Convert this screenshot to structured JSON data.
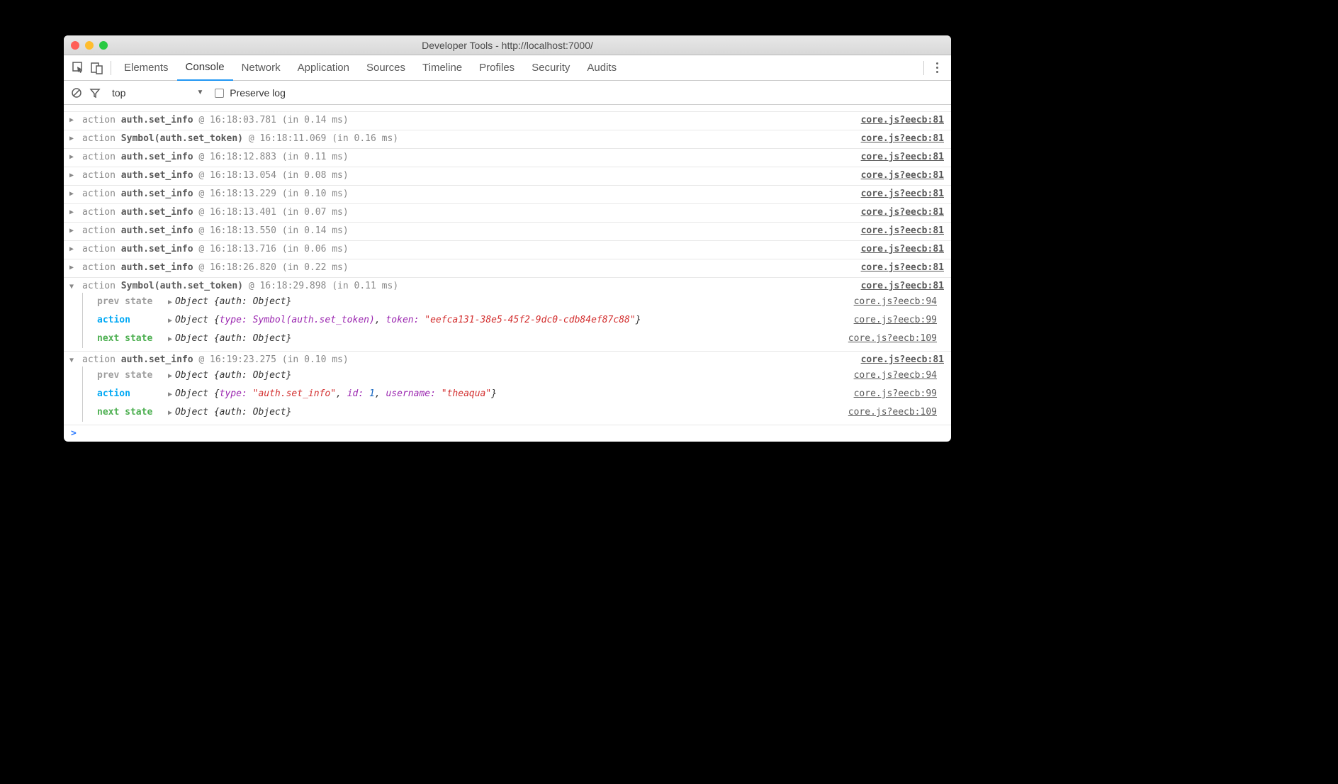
{
  "window": {
    "title": "Developer Tools - http://localhost:7000/"
  },
  "tabs": {
    "elements": "Elements",
    "console": "Console",
    "network": "Network",
    "application": "Application",
    "sources": "Sources",
    "timeline": "Timeline",
    "profiles": "Profiles",
    "security": "Security",
    "audits": "Audits"
  },
  "filterbar": {
    "context": "top",
    "preserve_log": "Preserve log"
  },
  "kw": {
    "action": "action",
    "prev_state": "prev state",
    "action_lbl": "action",
    "next_state": "next state",
    "object": "Object",
    "at": "@",
    "in_open": "(in ",
    "in_close": " ms)"
  },
  "logs": [
    {
      "name": "auth.set_info",
      "ts": "16:18:03.781",
      "dur": "0.14",
      "src": "core.js?eecb:81",
      "expanded": false
    },
    {
      "name": "Symbol(auth.set_token)",
      "ts": "16:18:11.069",
      "dur": "0.16",
      "src": "core.js?eecb:81",
      "expanded": false
    },
    {
      "name": "auth.set_info",
      "ts": "16:18:12.883",
      "dur": "0.11",
      "src": "core.js?eecb:81",
      "expanded": false
    },
    {
      "name": "auth.set_info",
      "ts": "16:18:13.054",
      "dur": "0.08",
      "src": "core.js?eecb:81",
      "expanded": false
    },
    {
      "name": "auth.set_info",
      "ts": "16:18:13.229",
      "dur": "0.10",
      "src": "core.js?eecb:81",
      "expanded": false
    },
    {
      "name": "auth.set_info",
      "ts": "16:18:13.401",
      "dur": "0.07",
      "src": "core.js?eecb:81",
      "expanded": false
    },
    {
      "name": "auth.set_info",
      "ts": "16:18:13.550",
      "dur": "0.14",
      "src": "core.js?eecb:81",
      "expanded": false
    },
    {
      "name": "auth.set_info",
      "ts": "16:18:13.716",
      "dur": "0.06",
      "src": "core.js?eecb:81",
      "expanded": false
    },
    {
      "name": "auth.set_info",
      "ts": "16:18:26.820",
      "dur": "0.22",
      "src": "core.js?eecb:81",
      "expanded": false
    }
  ],
  "exp1": {
    "name": "Symbol(auth.set_token)",
    "ts": "16:18:29.898",
    "dur": "0.11",
    "src": "core.js?eecb:81",
    "prev_src": "core.js?eecb:94",
    "action_src": "core.js?eecb:99",
    "next_src": "core.js?eecb:109",
    "prev_text": "{auth: Object}",
    "next_text": "{auth: Object}",
    "action_obj": {
      "type_key": "type:",
      "type_val": "Symbol(auth.set_token)",
      "token_key": "token:",
      "token_val": "\"eefca131-38e5-45f2-9dc0-cdb84ef87c88\""
    }
  },
  "exp2": {
    "name": "auth.set_info",
    "ts": "16:19:23.275",
    "dur": "0.10",
    "src": "core.js?eecb:81",
    "prev_src": "core.js?eecb:94",
    "action_src": "core.js?eecb:99",
    "next_src": "core.js?eecb:109",
    "prev_text": "{auth: Object}",
    "next_text": "{auth: Object}",
    "action_obj": {
      "type_key": "type:",
      "type_val": "\"auth.set_info\"",
      "id_key": "id:",
      "id_val": "1",
      "username_key": "username:",
      "username_val": "\"theaqua\""
    }
  },
  "prompt": ">"
}
